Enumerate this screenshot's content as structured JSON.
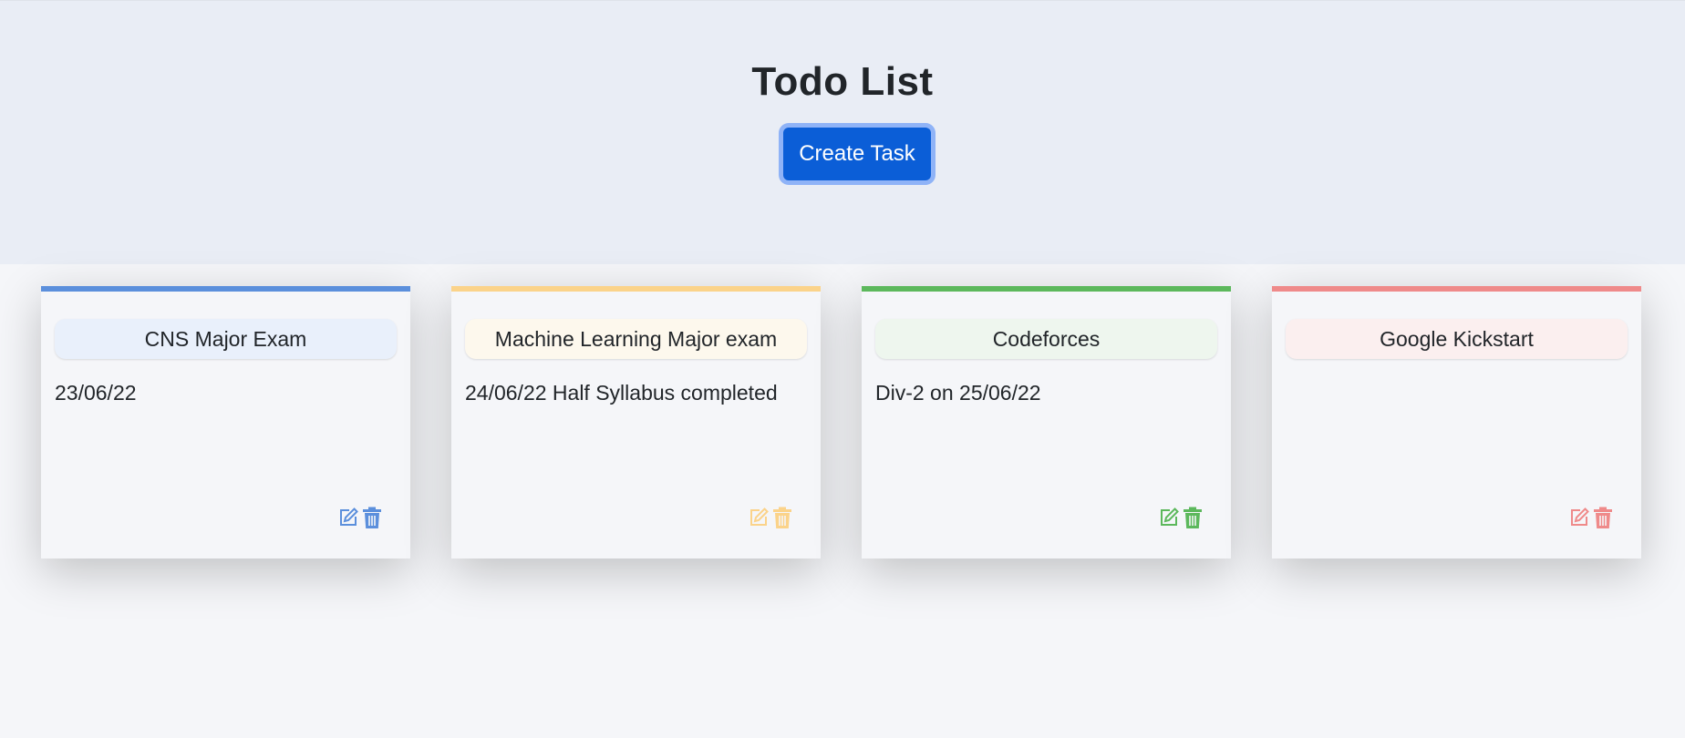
{
  "page": {
    "title": "Todo List",
    "create_button": "Create Task"
  },
  "colors": {
    "primary_button": "#0b5ed7",
    "header_bg": "#e9edf5",
    "page_bg": "#f5f6f9"
  },
  "tasks": [
    {
      "name": "CNS Major Exam",
      "description": "23/06/22",
      "accent": "#5b8fdc",
      "tint": "#e9f0fb",
      "edit_icon": "edit-icon",
      "delete_icon": "trash-icon"
    },
    {
      "name": "Machine Learning Major exam",
      "description": "24/06/22 Half Syllabus completed",
      "accent": "#fbd38a",
      "tint": "#fdf8ed",
      "edit_icon": "edit-icon",
      "delete_icon": "trash-icon"
    },
    {
      "name": "Codeforces",
      "description": "Div-2 on 25/06/22",
      "accent": "#5cb85c",
      "tint": "#eef6ee",
      "edit_icon": "edit-icon",
      "delete_icon": "trash-icon"
    },
    {
      "name": "Google Kickstart",
      "description": "",
      "accent": "#ef8a8a",
      "tint": "#fbefef",
      "edit_icon": "edit-icon",
      "delete_icon": "trash-icon"
    }
  ]
}
